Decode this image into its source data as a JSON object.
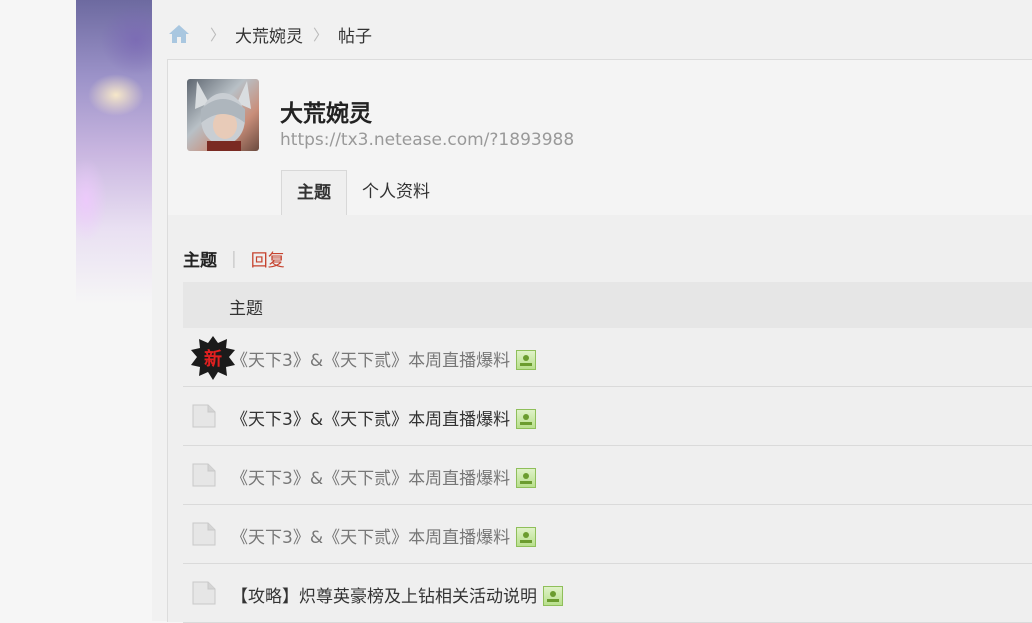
{
  "breadcrumb": {
    "home_icon": "home-icon",
    "items": [
      "大荒婉灵",
      "帖子"
    ]
  },
  "profile": {
    "title": "大荒婉灵",
    "url": "https://tx3.netease.com/?1893988",
    "avatar": "avatar-image"
  },
  "tabs": [
    {
      "label": "主题",
      "active": true
    },
    {
      "label": "个人资料",
      "active": false
    }
  ],
  "subnav": {
    "current": "主题",
    "other": "回复"
  },
  "table": {
    "header": "主题",
    "rows": [
      {
        "title": "《天下3》&《天下贰》本周直播爆料",
        "icon": "new-badge-icon",
        "has_image": true,
        "muted": true
      },
      {
        "title": "《天下3》&《天下贰》本周直播爆料",
        "icon": "thread-icon",
        "has_image": true,
        "muted": false
      },
      {
        "title": "《天下3》&《天下贰》本周直播爆料",
        "icon": "thread-icon",
        "has_image": true,
        "muted": true
      },
      {
        "title": "《天下3》&《天下贰》本周直播爆料",
        "icon": "thread-icon",
        "has_image": true,
        "muted": true
      },
      {
        "title": "【攻略】炽尊英豪榜及上钻相关活动说明",
        "icon": "thread-icon",
        "has_image": true,
        "muted": false
      }
    ]
  },
  "colors": {
    "accent": "#c6432f",
    "home_icon": "#a9c7e0"
  }
}
